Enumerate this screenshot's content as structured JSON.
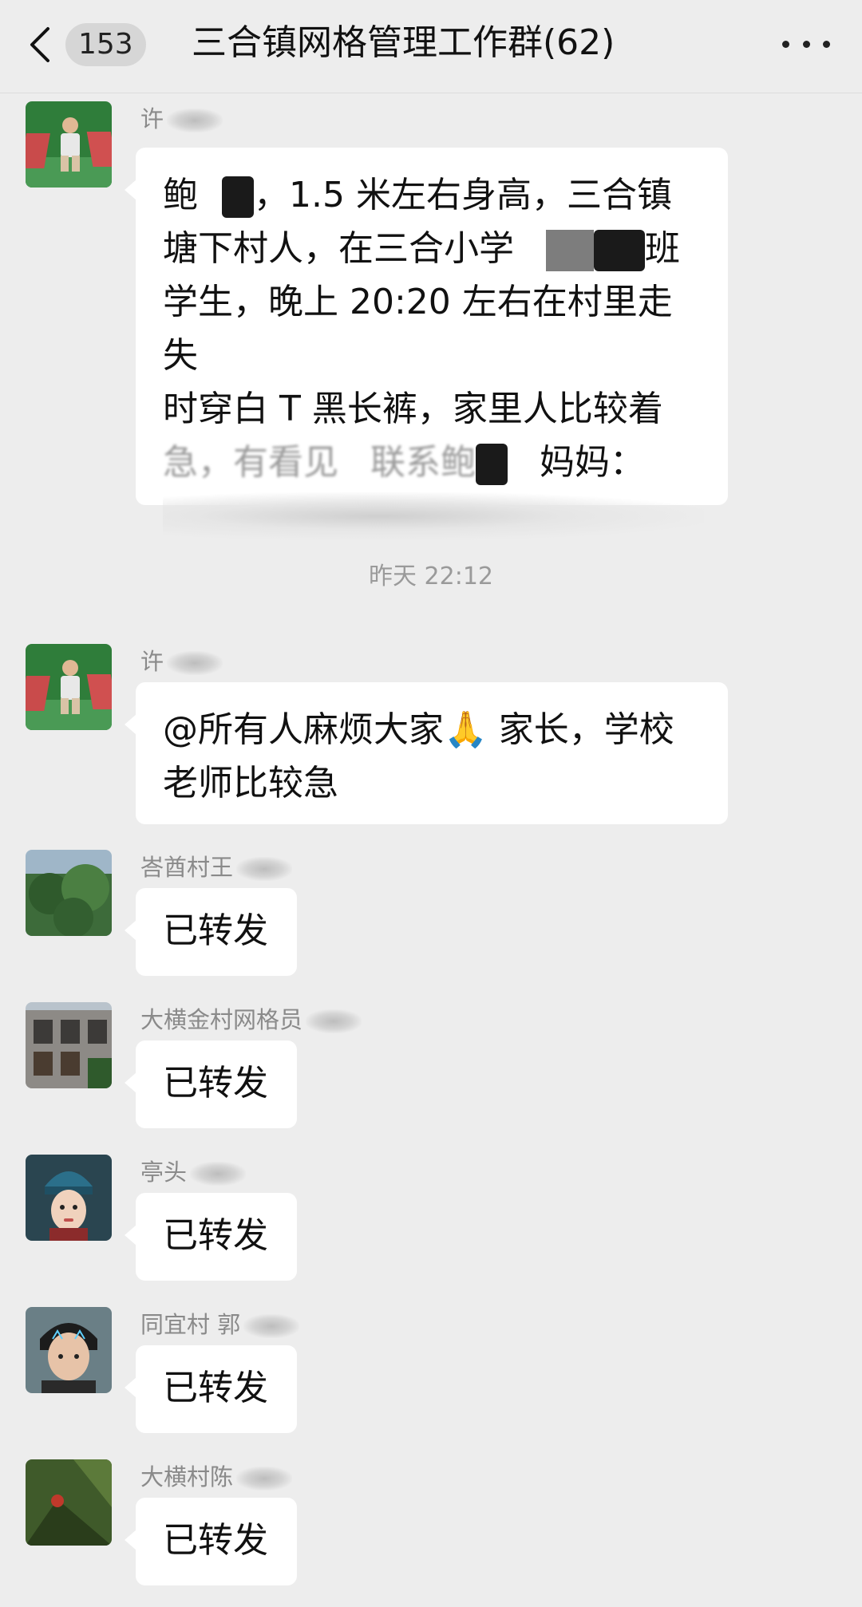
{
  "header": {
    "unread_count": "153",
    "title": "三合镇网格管理工作群(62)"
  },
  "timestamp": "昨天 22:12",
  "messages": [
    {
      "sender": "许",
      "lines": [
        "鲍",
        "，1.5 米左右身高，三合镇",
        "塘下村人，在三合小学",
        "班",
        "学生，晚上 20:20 左右在村里走失",
        "时穿白 T 黑长裤，家里人比较着",
        "急，有看见",
        "联系鲍",
        "妈妈："
      ]
    },
    {
      "sender": "许",
      "text_line1": "@所有人麻烦大家",
      "emoji": "🙏",
      "text_line1b": " 家长，学校",
      "text_line2": "老师比较急"
    },
    {
      "sender": "峇酋村王",
      "text": "已转发"
    },
    {
      "sender": "大横金村网格员",
      "text": "已转发"
    },
    {
      "sender": "亭头",
      "text": "已转发"
    },
    {
      "sender": "同宜村 郭",
      "text": "已转发"
    },
    {
      "sender": "大横村陈",
      "text": "已转发"
    }
  ],
  "colors": {
    "background": "#ededed",
    "bubble": "#ffffff",
    "sender_text": "#8a8a8a"
  },
  "icons": {
    "back": "chevron-left-icon",
    "more": "more-dots-icon"
  }
}
